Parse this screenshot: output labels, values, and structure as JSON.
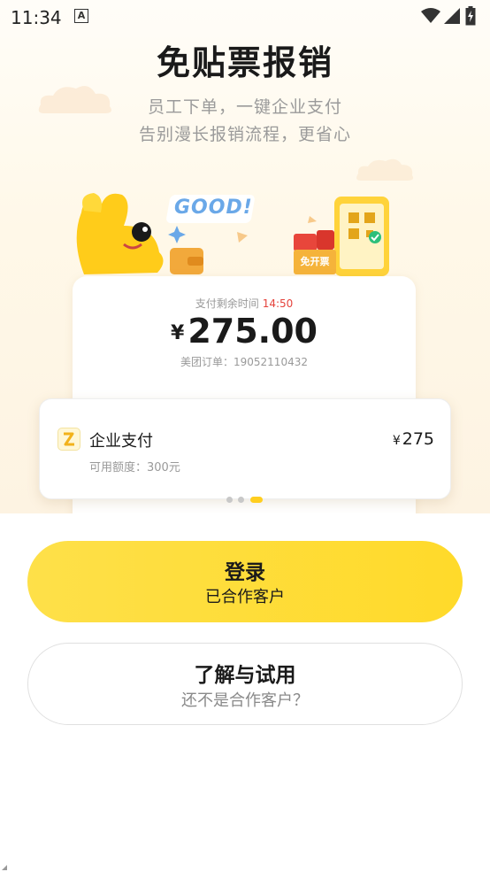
{
  "status_bar": {
    "time": "11:34",
    "notification_icon": "text-a-icon",
    "icons": [
      "wifi-icon",
      "signal-icon",
      "battery-charging-icon"
    ]
  },
  "hero": {
    "title": "免贴票报销",
    "subtitle_line1": "员工下单，一键企业支付",
    "subtitle_line2": "告别漫长报销流程，更省心",
    "good_text": "GOOD!",
    "badge_text": "免开票"
  },
  "payment_card": {
    "remaining_label": "支付剩余时间",
    "remaining_time": "14:50",
    "currency": "¥",
    "amount": "275.00",
    "order_label": "美团订单：19052110432"
  },
  "enterprise_card": {
    "title": "企业支付",
    "quota": "可用额度：300元",
    "currency": "¥",
    "amount": "275"
  },
  "carousel": {
    "count": 3,
    "active_index": 2
  },
  "login_button": {
    "title": "登录",
    "subtitle": "已合作客户"
  },
  "trial_button": {
    "title": "了解与试用",
    "subtitle": "还不是合作客户？"
  },
  "colors": {
    "accent_yellow": "#ffd91f",
    "countdown_red": "#e5423b",
    "text_dark": "#1a1a1a",
    "text_gray": "#999999"
  }
}
